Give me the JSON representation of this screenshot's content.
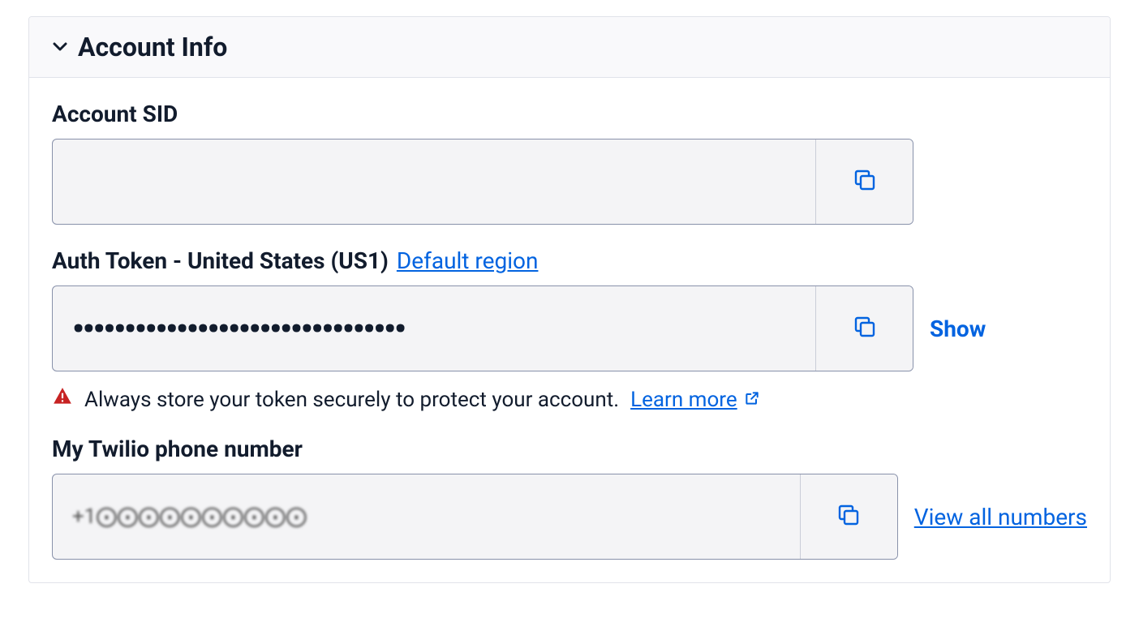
{
  "panel": {
    "title": "Account Info"
  },
  "account_sid": {
    "label": "Account SID",
    "value": ""
  },
  "auth_token": {
    "label": "Auth Token - United States (US1)",
    "region_link": "Default region",
    "masked_value": "••••••••••••••••••••••••••••••••",
    "show_label": "Show",
    "warning_text": "Always store your token securely to protect your account.",
    "learn_more": "Learn more"
  },
  "phone": {
    "label": "My Twilio phone number",
    "value": "+1⨀⨀⨀⨀⨀⨀⨀⨀⨀⨀",
    "view_all": "View all numbers"
  }
}
